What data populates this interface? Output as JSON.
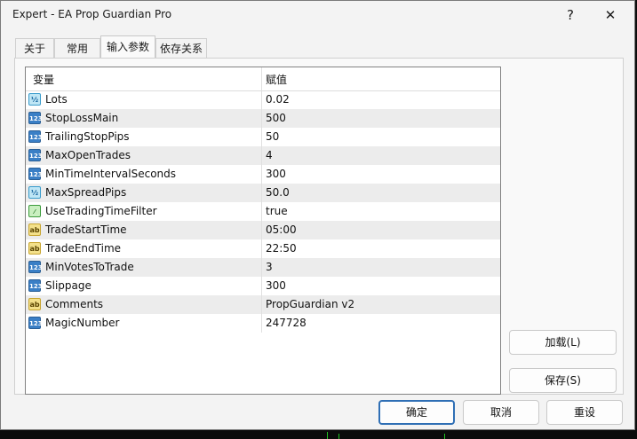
{
  "window": {
    "title": "Expert - EA Prop Guardian Pro",
    "help_label": "?",
    "close_label": "✕"
  },
  "tabs": [
    {
      "label": "关于"
    },
    {
      "label": "常用"
    },
    {
      "label": "输入参数",
      "active": true
    },
    {
      "label": "依存关系"
    }
  ],
  "grid": {
    "header_variable": "变量",
    "header_value": "赋值",
    "rows": [
      {
        "icon": "double-type-icon",
        "icon_text": "½",
        "name": "Lots",
        "value": "0.02"
      },
      {
        "icon": "integer-type-icon",
        "icon_text": "123",
        "name": "StopLossMain",
        "value": "500"
      },
      {
        "icon": "integer-type-icon",
        "icon_text": "123",
        "name": "TrailingStopPips",
        "value": "50"
      },
      {
        "icon": "integer-type-icon",
        "icon_text": "123",
        "name": "MaxOpenTrades",
        "value": "4"
      },
      {
        "icon": "integer-type-icon",
        "icon_text": "123",
        "name": "MinTimeIntervalSeconds",
        "value": "300"
      },
      {
        "icon": "double-type-icon",
        "icon_text": "½",
        "name": "MaxSpreadPips",
        "value": "50.0"
      },
      {
        "icon": "boolean-type-icon",
        "icon_text": "⁄",
        "name": "UseTradingTimeFilter",
        "value": "true"
      },
      {
        "icon": "string-type-icon",
        "icon_text": "ab",
        "name": "TradeStartTime",
        "value": "05:00"
      },
      {
        "icon": "string-type-icon",
        "icon_text": "ab",
        "name": "TradeEndTime",
        "value": "22:50"
      },
      {
        "icon": "integer-type-icon",
        "icon_text": "123",
        "name": "MinVotesToTrade",
        "value": "3"
      },
      {
        "icon": "integer-type-icon",
        "icon_text": "123",
        "name": "Slippage",
        "value": "300"
      },
      {
        "icon": "string-type-icon",
        "icon_text": "ab",
        "name": "Comments",
        "value": "PropGuardian v2"
      },
      {
        "icon": "integer-type-icon",
        "icon_text": "123",
        "name": "MagicNumber",
        "value": "247728"
      }
    ]
  },
  "buttons": {
    "load": "加载(L)",
    "save": "保存(S)",
    "ok": "确定",
    "cancel": "取消",
    "reset": "重设"
  },
  "colors": {
    "accent": "#2f6fb5",
    "background": "#0b0b0b",
    "chart_line": "#22c322"
  }
}
